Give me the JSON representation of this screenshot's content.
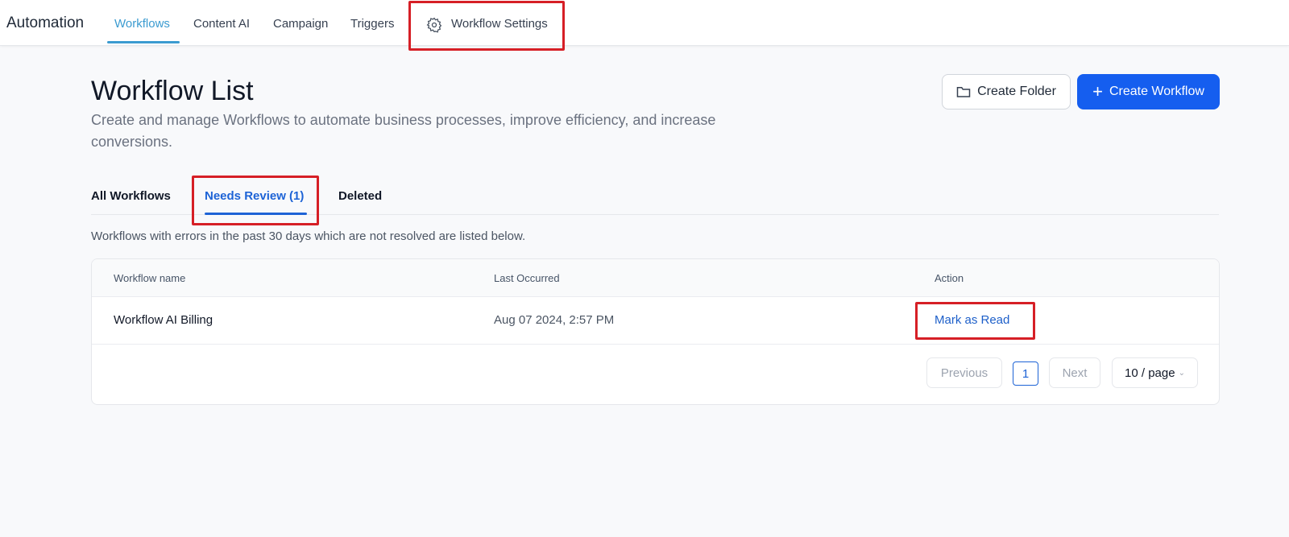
{
  "header": {
    "brand": "Automation",
    "nav": [
      "Workflows",
      "Content AI",
      "Campaign",
      "Triggers"
    ],
    "settings": "Workflow Settings"
  },
  "page": {
    "title": "Workflow List",
    "subtitle": "Create and manage Workflows to automate business processes, improve efficiency, and increase conversions.",
    "create_folder": "Create Folder",
    "create_workflow": "Create Workflow"
  },
  "tabs": [
    "All Workflows",
    "Needs Review (1)",
    "Deleted"
  ],
  "note": "Workflows with errors in the past 30 days which are not resolved are listed below.",
  "table": {
    "columns": [
      "Workflow name",
      "Last Occurred",
      "Action"
    ],
    "rows": [
      {
        "name": "Workflow AI Billing",
        "last": "Aug 07 2024, 2:57 PM",
        "action": "Mark as Read"
      }
    ]
  },
  "pagination": {
    "prev": "Previous",
    "page": "1",
    "next": "Next",
    "per_page": "10 / page"
  },
  "colors": {
    "primary": "#155eef",
    "annotation": "#d61f26"
  }
}
